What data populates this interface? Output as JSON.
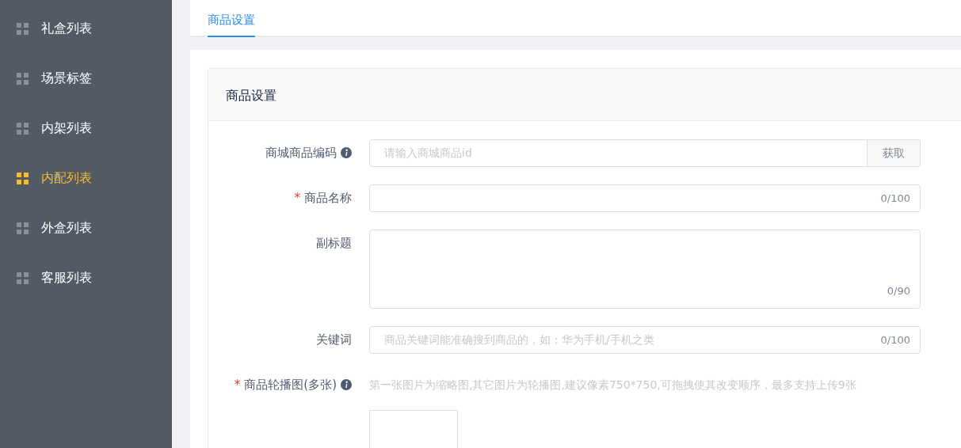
{
  "sidebar": {
    "items": [
      {
        "label": "礼盒列表",
        "selected": false
      },
      {
        "label": "场景标签",
        "selected": false
      },
      {
        "label": "内架列表",
        "selected": false
      },
      {
        "label": "内配列表",
        "selected": true
      },
      {
        "label": "外盒列表",
        "selected": false
      },
      {
        "label": "客服列表",
        "selected": false
      }
    ]
  },
  "tabs": [
    {
      "label": "商品设置",
      "selected": true
    }
  ],
  "card": {
    "title": "商品设置",
    "fields": [
      {
        "kind": "input-button",
        "label": "商城商品编码",
        "info": true,
        "placeholder": "请输入商城商品id",
        "button": "获取"
      },
      {
        "kind": "input",
        "label": "商品名称",
        "required_mark": "*",
        "info": false,
        "counter": "0/100"
      },
      {
        "kind": "textarea",
        "label": "副标题",
        "info": false,
        "counter": "0/90"
      },
      {
        "kind": "input",
        "label": "关键词",
        "info": false,
        "placeholder": "商品关键词能准确搜到商品的，如：华为手机/手机之类",
        "counter": "0/100"
      },
      {
        "kind": "upload",
        "label": "商品轮播图(多张)",
        "required_mark": "*",
        "info": true,
        "hint": "第一张图片为缩略图,其它图片为轮播图,建议像素750*750,可拖拽使其改变顺序，最多支持上传9张"
      }
    ]
  }
}
